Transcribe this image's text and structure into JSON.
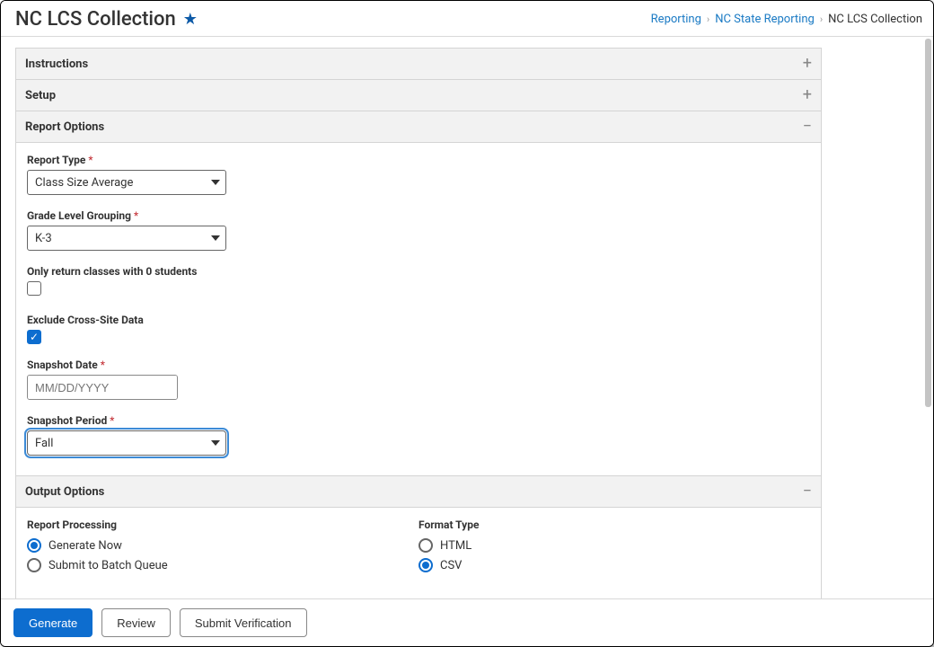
{
  "header": {
    "title": "NC LCS Collection"
  },
  "breadcrumb": {
    "reporting": "Reporting",
    "state": "NC State Reporting",
    "current": "NC LCS Collection"
  },
  "sections": {
    "instructions_label": "Instructions",
    "setup_label": "Setup",
    "report_options_label": "Report Options",
    "output_options_label": "Output Options"
  },
  "report_options": {
    "report_type_label": "Report Type",
    "report_type_value": "Class Size Average",
    "grade_grouping_label": "Grade Level Grouping",
    "grade_grouping_value": "K-3",
    "only_zero_label": "Only return classes with 0 students",
    "exclude_cross_label": "Exclude Cross-Site Data",
    "snapshot_date_label": "Snapshot Date",
    "snapshot_date_placeholder": "MM/DD/YYYY",
    "snapshot_period_label": "Snapshot Period",
    "snapshot_period_value": "Fall"
  },
  "output": {
    "processing_label": "Report Processing",
    "generate_now": "Generate Now",
    "submit_batch": "Submit to Batch Queue",
    "format_label": "Format Type",
    "format_html": "HTML",
    "format_csv": "CSV"
  },
  "footer": {
    "generate": "Generate",
    "review": "Review",
    "submit_verif": "Submit Verification"
  }
}
